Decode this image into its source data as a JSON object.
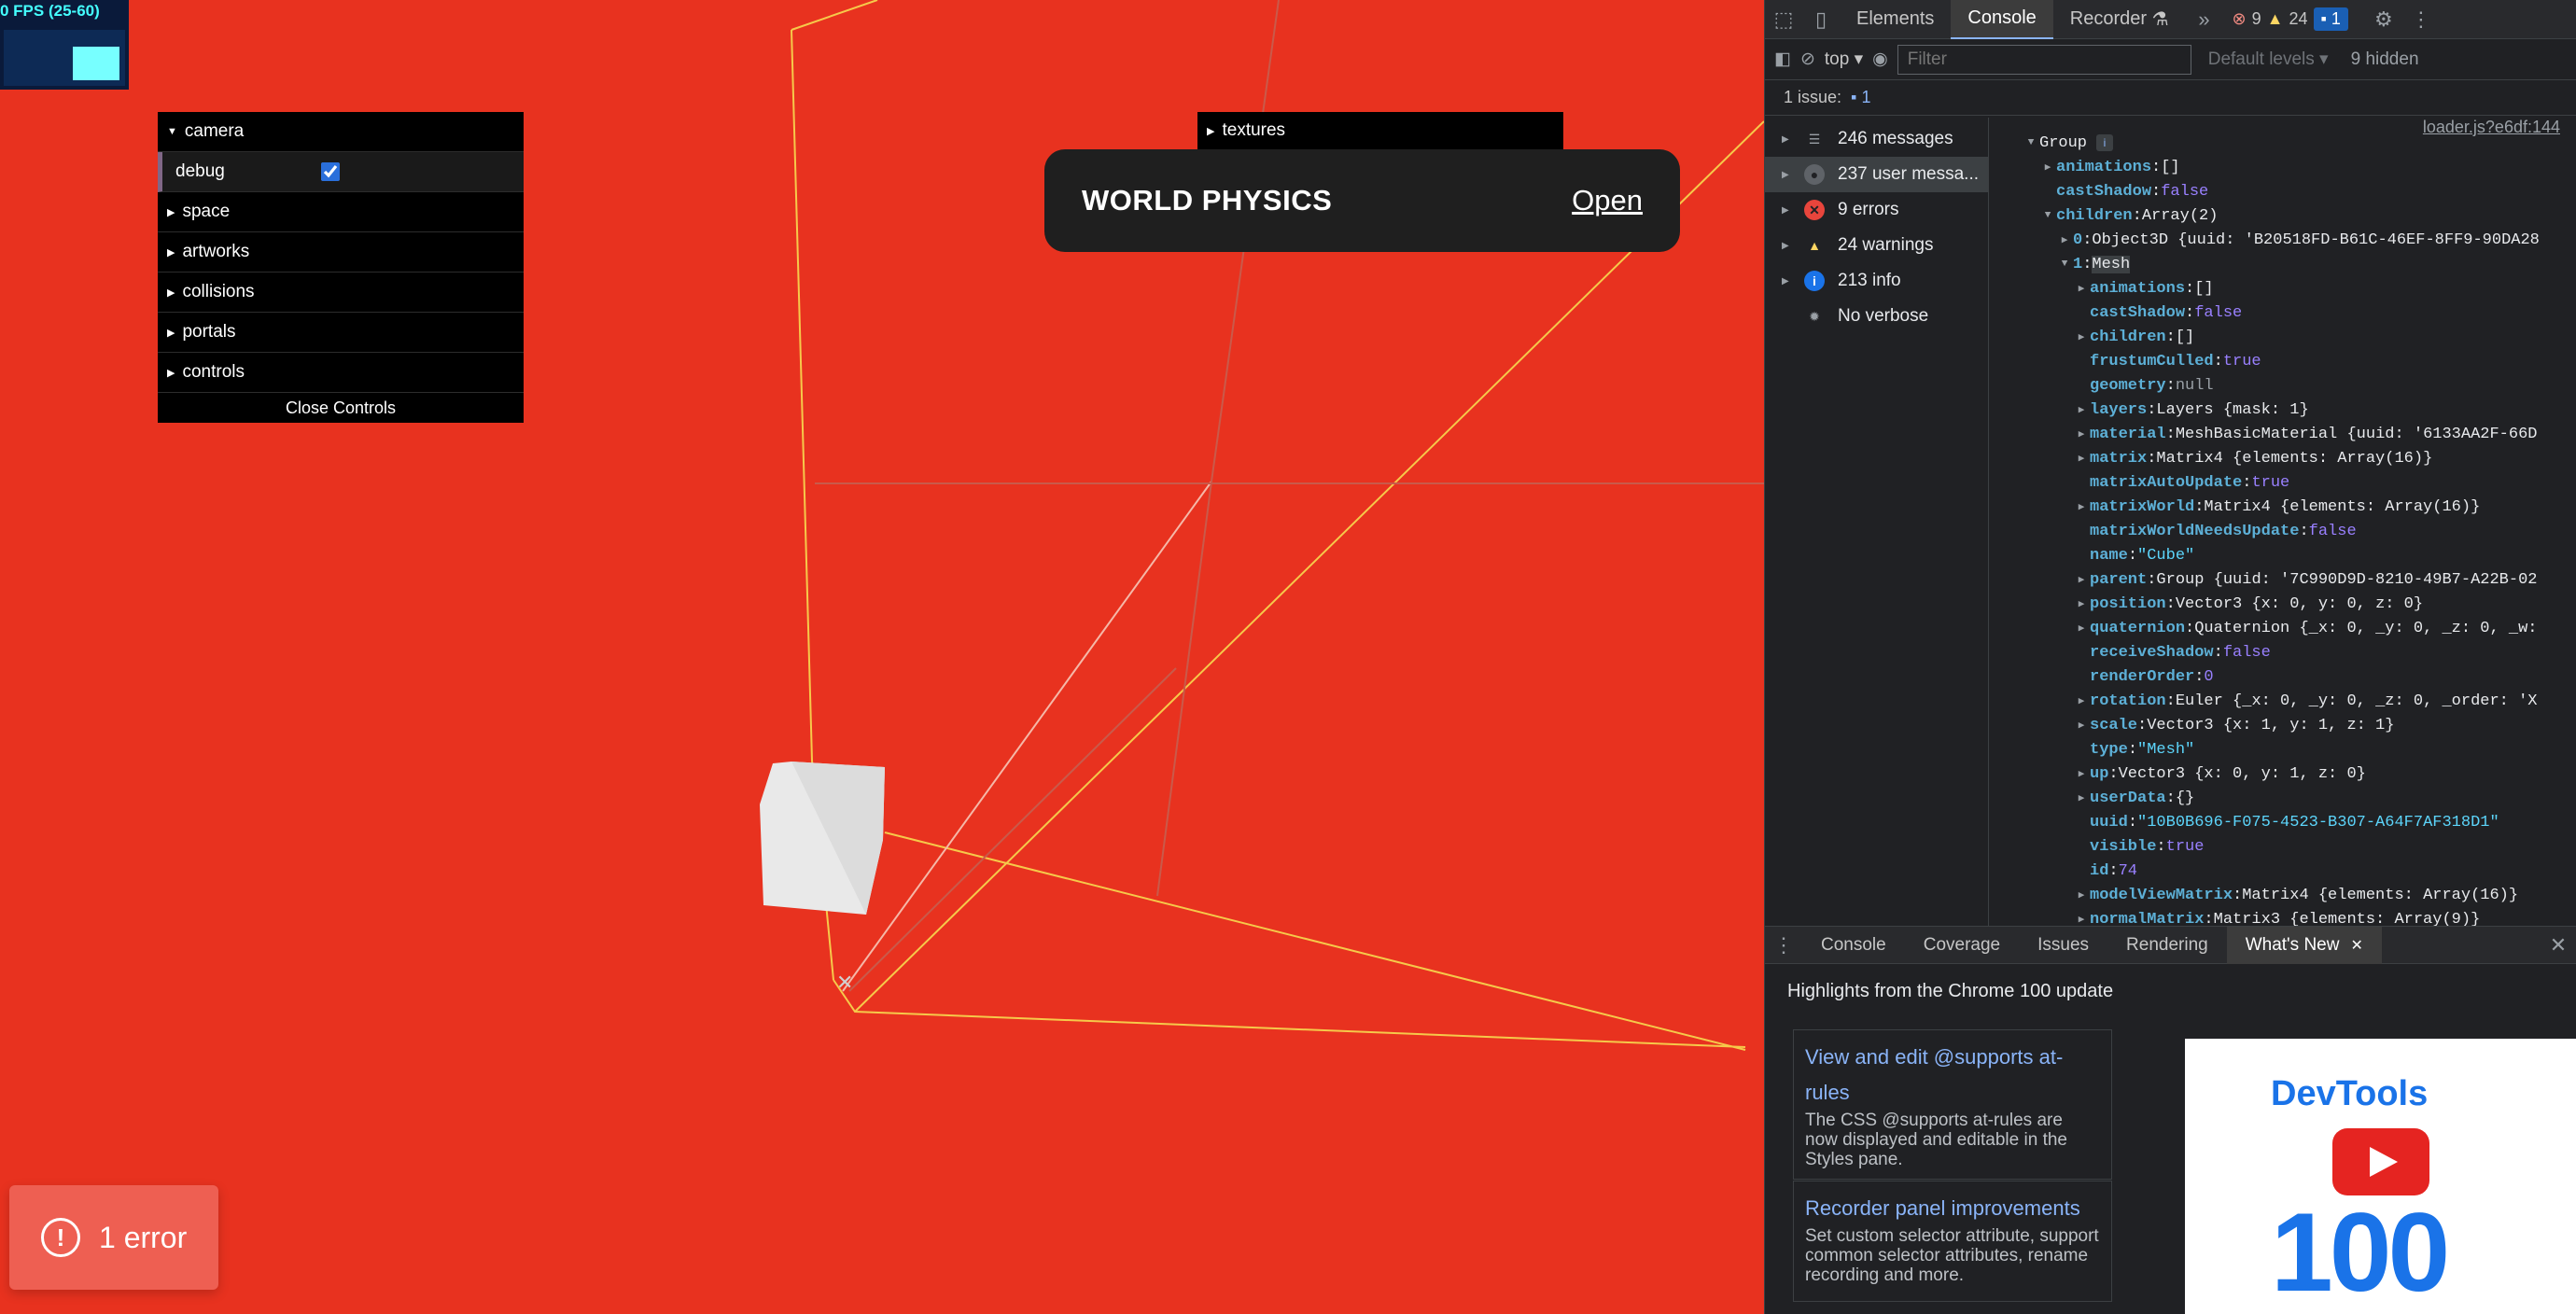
{
  "stats": {
    "label": "0 FPS (25-60)"
  },
  "gui_left": {
    "items": [
      {
        "label": "camera",
        "open": true
      },
      {
        "label": "debug",
        "checked": true
      },
      {
        "label": "space"
      },
      {
        "label": "artworks"
      },
      {
        "label": "collisions"
      },
      {
        "label": "portals"
      },
      {
        "label": "controls"
      }
    ],
    "close": "Close Controls"
  },
  "gui_right": {
    "label": "textures"
  },
  "popup": {
    "title": "WORLD PHYSICS",
    "link": "Open"
  },
  "toast": {
    "icon": "!",
    "text": "1 error"
  },
  "devtools": {
    "tabs": [
      "Elements",
      "Console",
      "Recorder"
    ],
    "active_tab": "Console",
    "counts": {
      "errors": "9",
      "warnings": "24",
      "messages": "1"
    },
    "toolbar": {
      "context": "top",
      "filter_placeholder": "Filter",
      "levels": "Default levels",
      "hidden": "9 hidden"
    },
    "issues": {
      "label": "1 issue:",
      "count": "1"
    },
    "sidebar": [
      {
        "label": "246 messages",
        "icon": "list-icon"
      },
      {
        "label": "237 user messa...",
        "icon": "user-icon"
      },
      {
        "label": "9 errors",
        "icon": "error-icon"
      },
      {
        "label": "24 warnings",
        "icon": "warning-icon"
      },
      {
        "label": "213 info",
        "icon": "info-icon"
      },
      {
        "label": "No verbose",
        "icon": "verbose-icon"
      }
    ],
    "source": "loader.js?e6df:144",
    "tree": [
      {
        "i": 0,
        "a": "▼",
        "k": "Group",
        "plain": true
      },
      {
        "i": 1,
        "a": "▶",
        "k": "animations",
        "v": "[]",
        "t": "t"
      },
      {
        "i": 1,
        "a": "",
        "k": "castShadow",
        "v": "false",
        "t": "b"
      },
      {
        "i": 1,
        "a": "▼",
        "k": "children",
        "v": "Array(2)",
        "t": "t"
      },
      {
        "i": 2,
        "a": "▶",
        "k": "0",
        "v": "Object3D {uuid: 'B20518FD-B61C-46EF-8FF9-90DA28",
        "t": "t"
      },
      {
        "i": 2,
        "a": "▼",
        "k": "1",
        "v": "Mesh",
        "t": "t"
      },
      {
        "i": 3,
        "a": "▶",
        "k": "animations",
        "v": "[]",
        "t": "t"
      },
      {
        "i": 3,
        "a": "",
        "k": "castShadow",
        "v": "false",
        "t": "b"
      },
      {
        "i": 3,
        "a": "▶",
        "k": "children",
        "v": "[]",
        "t": "t"
      },
      {
        "i": 3,
        "a": "",
        "k": "frustumCulled",
        "v": "true",
        "t": "b"
      },
      {
        "i": 3,
        "a": "",
        "k": "geometry",
        "v": "null",
        "t": "null"
      },
      {
        "i": 3,
        "a": "▶",
        "k": "layers",
        "v": "Layers {mask: 1}",
        "t": "t"
      },
      {
        "i": 3,
        "a": "▶",
        "k": "material",
        "v": "MeshBasicMaterial {uuid: '6133AA2F-66D",
        "t": "t"
      },
      {
        "i": 3,
        "a": "▶",
        "k": "matrix",
        "v": "Matrix4 {elements: Array(16)}",
        "t": "t"
      },
      {
        "i": 3,
        "a": "",
        "k": "matrixAutoUpdate",
        "v": "true",
        "t": "b"
      },
      {
        "i": 3,
        "a": "▶",
        "k": "matrixWorld",
        "v": "Matrix4 {elements: Array(16)}",
        "t": "t"
      },
      {
        "i": 3,
        "a": "",
        "k": "matrixWorldNeedsUpdate",
        "v": "false",
        "t": "b"
      },
      {
        "i": 3,
        "a": "",
        "k": "name",
        "v": "\"Cube\"",
        "t": "s"
      },
      {
        "i": 3,
        "a": "▶",
        "k": "parent",
        "v": "Group {uuid: '7C990D9D-8210-49B7-A22B-02",
        "t": "t"
      },
      {
        "i": 3,
        "a": "▶",
        "k": "position",
        "v": "Vector3 {x: 0, y: 0, z: 0}",
        "t": "t"
      },
      {
        "i": 3,
        "a": "▶",
        "k": "quaternion",
        "v": "Quaternion {_x: 0, _y: 0, _z: 0, _w:",
        "t": "t"
      },
      {
        "i": 3,
        "a": "",
        "k": "receiveShadow",
        "v": "false",
        "t": "b"
      },
      {
        "i": 3,
        "a": "",
        "k": "renderOrder",
        "v": "0",
        "t": "n"
      },
      {
        "i": 3,
        "a": "▶",
        "k": "rotation",
        "v": "Euler {_x: 0, _y: 0, _z: 0, _order: 'X",
        "t": "t"
      },
      {
        "i": 3,
        "a": "▶",
        "k": "scale",
        "v": "Vector3 {x: 1, y: 1, z: 1}",
        "t": "t"
      },
      {
        "i": 3,
        "a": "",
        "k": "type",
        "v": "\"Mesh\"",
        "t": "s"
      },
      {
        "i": 3,
        "a": "▶",
        "k": "up",
        "v": "Vector3 {x: 0, y: 1, z: 0}",
        "t": "t"
      },
      {
        "i": 3,
        "a": "▶",
        "k": "userData",
        "v": "{}",
        "t": "t"
      },
      {
        "i": 3,
        "a": "",
        "k": "uuid",
        "v": "\"10B0B696-F075-4523-B307-A64F7AF318D1\"",
        "t": "s"
      },
      {
        "i": 3,
        "a": "",
        "k": "visible",
        "v": "true",
        "t": "b"
      },
      {
        "i": 3,
        "a": "",
        "k": "id",
        "v": "74",
        "t": "n"
      },
      {
        "i": 3,
        "a": "▶",
        "k": "modelViewMatrix",
        "v": "Matrix4 {elements: Array(16)}",
        "t": "t"
      },
      {
        "i": 3,
        "a": "▶",
        "k": "normalMatrix",
        "v": "Matrix3 {elements: Array(9)}",
        "t": "t"
      }
    ],
    "drawer": {
      "tabs": [
        "Console",
        "Coverage",
        "Issues",
        "Rendering",
        "What's New"
      ],
      "active": "What's New",
      "heading": "Highlights from the Chrome 100 update",
      "cards": [
        {
          "title": "View and edit @supports at-rules",
          "desc": "The CSS @supports at-rules are now displayed and editable in the Styles pane."
        },
        {
          "title": "Recorder panel improvements",
          "desc": "Set custom selector attribute, support common selector attributes, rename recording and more."
        }
      ],
      "promo": {
        "title": "DevTools",
        "number": "100"
      }
    }
  },
  "colors": {
    "scene_bg": "#e8321f",
    "accent": "#1a73e8"
  }
}
